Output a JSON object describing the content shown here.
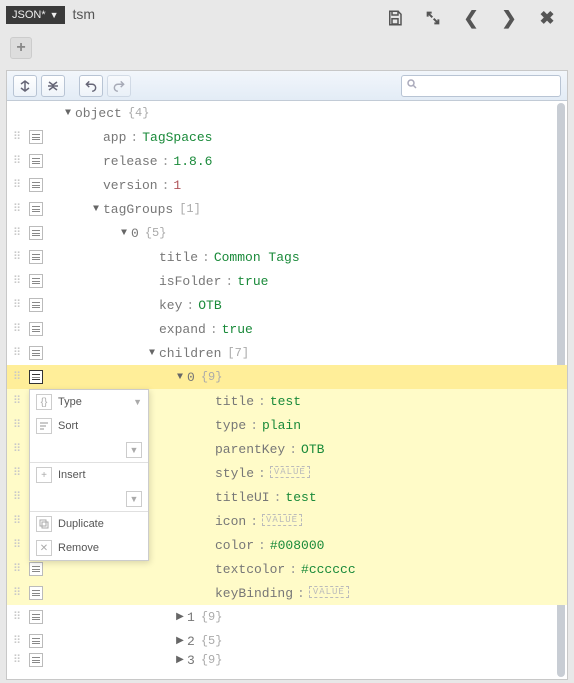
{
  "header": {
    "mode_label": "JSON*",
    "file_title": "tsm"
  },
  "toolbar": {
    "search_placeholder": ""
  },
  "tree": {
    "root_label": "object",
    "root_meta": "{4}",
    "app_key": "app",
    "app_val": "TagSpaces",
    "release_key": "release",
    "release_val": "1.8.6",
    "version_key": "version",
    "version_val": "1",
    "taggroups_key": "tagGroups",
    "taggroups_meta": "[1]",
    "tg0_key": "0",
    "tg0_meta": "{5}",
    "tg0_title_key": "title",
    "tg0_title_val": "Common Tags",
    "tg0_isfolder_key": "isFolder",
    "tg0_isfolder_val": "true",
    "tg0_key_key": "key",
    "tg0_key_val": "OTB",
    "tg0_expand_key": "expand",
    "tg0_expand_val": "true",
    "tg0_children_key": "children",
    "tg0_children_meta": "[7]",
    "c0_key": "0",
    "c0_meta": "{9}",
    "c0_title_key": "title",
    "c0_title_val": "test",
    "c0_type_key": "type",
    "c0_type_val": "plain",
    "c0_parentkey_key": "parentKey",
    "c0_parentkey_val": "OTB",
    "c0_style_key": "style",
    "c0_titleui_key": "titleUI",
    "c0_titleui_val": "test",
    "c0_icon_key": "icon",
    "c0_color_key": "color",
    "c0_color_val": "#008000",
    "c0_textcolor_key": "textcolor",
    "c0_textcolor_val": "#cccccc",
    "c0_keybinding_key": "keyBinding",
    "c1_key": "1",
    "c1_meta": "{9}",
    "c2_key": "2",
    "c2_meta": "{5}",
    "c3_key": "3",
    "c3_meta": "{9}",
    "value_placeholder": "VALUE"
  },
  "contextmenu": {
    "type_label": "Type",
    "sort_label": "Sort",
    "insert_label": "Insert",
    "duplicate_label": "Duplicate",
    "remove_label": "Remove"
  }
}
